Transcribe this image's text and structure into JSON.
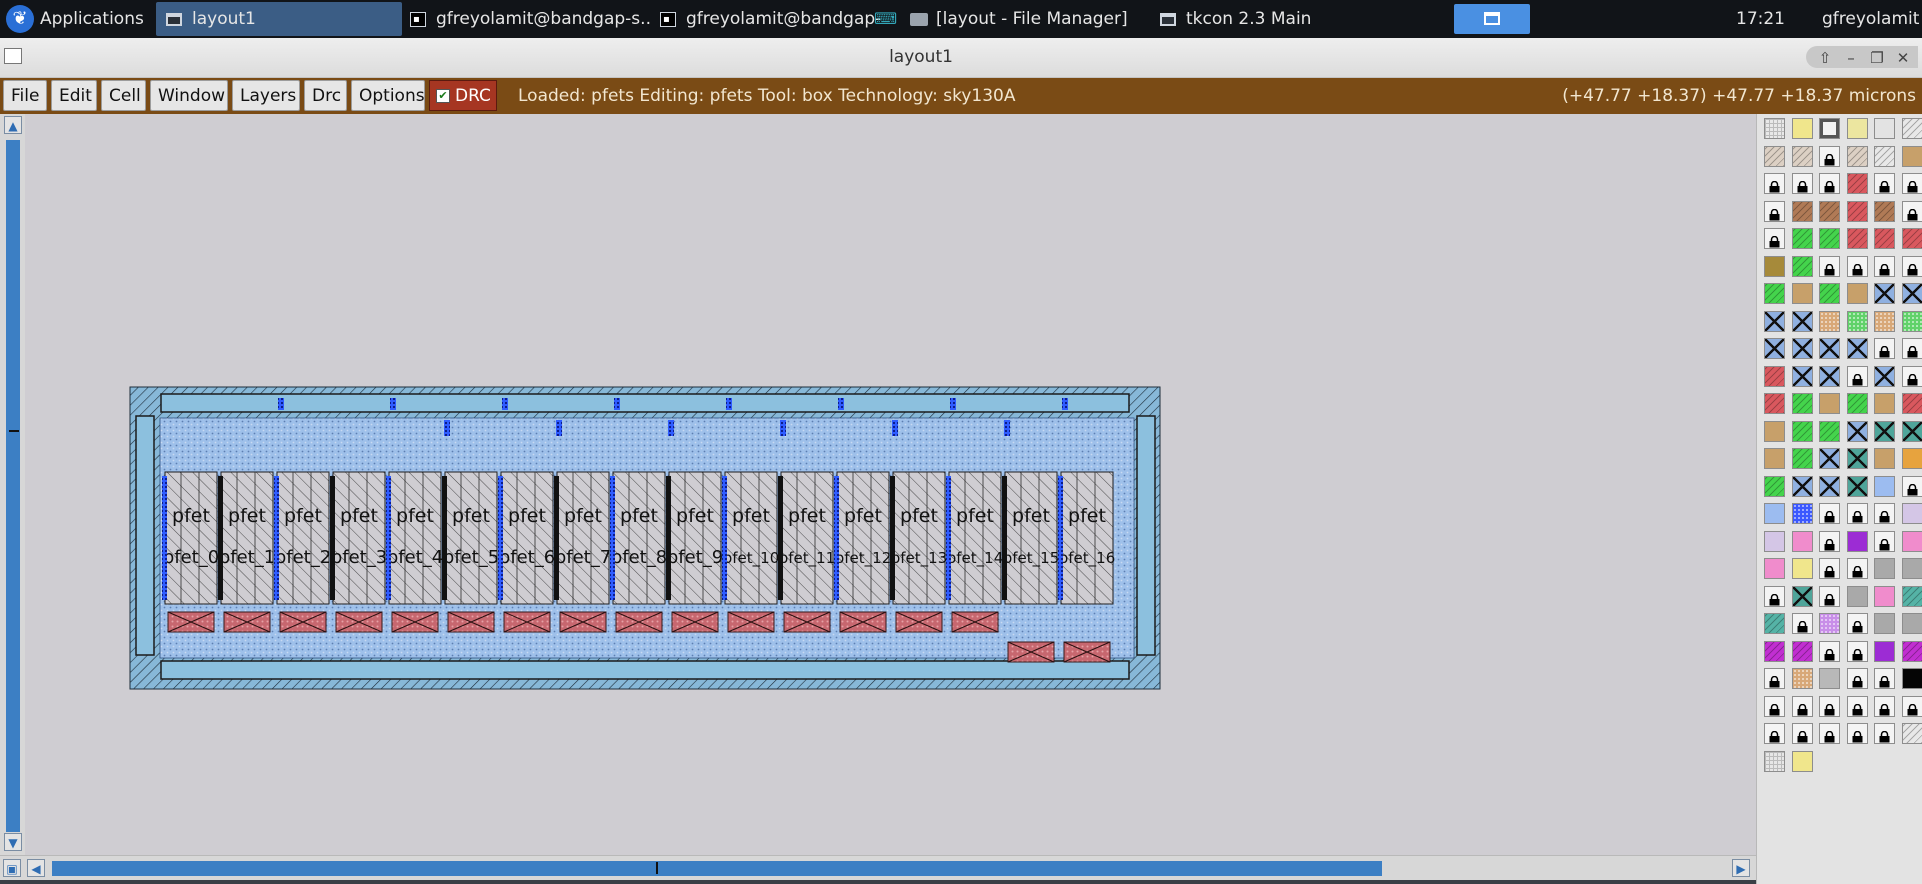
{
  "taskbar": {
    "applications_label": "Applications",
    "tasks": [
      {
        "label": "layout1",
        "active": true
      },
      {
        "label": "gfreyolamit@bandgap-s..."
      },
      {
        "label": "gfreyolamit@bandgap-"
      },
      {
        "label": "[layout - File Manager]"
      },
      {
        "label": "tkcon 2.3 Main"
      }
    ],
    "clock": "17:21",
    "user": "gfreyolamit"
  },
  "window": {
    "title": "layout1",
    "controls": [
      "up-arrow-icon",
      "minimize-icon",
      "maximize-icon",
      "close-icon"
    ]
  },
  "menu": {
    "items": [
      "File",
      "Edit",
      "Cell",
      "Window",
      "Layers",
      "Drc",
      "Options"
    ],
    "drc_label": "DRC",
    "drc_checked": true
  },
  "status": {
    "text": "Loaded: pfets Editing: pfets Tool: box  Technology: sky130A",
    "coords": "(+47.77 +18.37) +47.77 +18.37 microns"
  },
  "layout": {
    "cell_names": [
      "pfet",
      "pfet",
      "pfet",
      "pfet",
      "pfet",
      "pfet",
      "pfet",
      "pfet",
      "pfet",
      "pfet",
      "pfet",
      "pfet",
      "pfet",
      "pfet",
      "pfet",
      "pfet",
      "pfet"
    ],
    "instance_labels": [
      "pfet_0",
      "pfet_1",
      "pfet_2",
      "pfet_3",
      "pfet_4",
      "pfet_5",
      "pfet_6",
      "pfet_7",
      "pfet_8",
      "pfet_9",
      "pfet_10",
      "pfet_11",
      "pfet_12",
      "pfet_13",
      "pfet_14",
      "pfet_15",
      "pfet_16"
    ],
    "colors": {
      "canvas": "#cfcdd2",
      "diffusion": "#9cc3e0",
      "metal": "#8fb6e8",
      "contact": "#c56a73",
      "via": "#1b3fe0"
    }
  },
  "palette": {
    "rows": [
      [
        "grid",
        "yellow",
        "boxed",
        "pale-yellow",
        "blank",
        "hatch"
      ],
      [
        "beige-hatch",
        "beige-hatch",
        "lock",
        "beige-hatch",
        "hatch",
        "tan"
      ],
      [
        "lock",
        "lock",
        "lock",
        "red",
        "lock",
        "lock"
      ],
      [
        "lock",
        "brown",
        "brown",
        "red",
        "brown",
        "lock"
      ],
      [
        "lock",
        "green",
        "green",
        "red",
        "red",
        "red"
      ],
      [
        "olive",
        "green",
        "lock",
        "lock",
        "lock",
        "lock"
      ],
      [
        "green",
        "tan",
        "green",
        "tan",
        "blue-x",
        "blue-x"
      ],
      [
        "blue-x",
        "blue-x",
        "tan-dots",
        "green-dots",
        "tan-dots",
        "green-dots"
      ],
      [
        "blue-x",
        "blue-x",
        "blue-x",
        "blue-x",
        "lock",
        "lock"
      ],
      [
        "red",
        "blue-x",
        "blue-x",
        "lock",
        "blue-x",
        "lock"
      ],
      [
        "red",
        "green",
        "tan",
        "green",
        "tan",
        "red"
      ],
      [
        "tan",
        "green",
        "green",
        "blue-x",
        "teal-x",
        "teal-x"
      ],
      [
        "tan",
        "green",
        "blue-x",
        "teal-x",
        "tan",
        "orange"
      ],
      [
        "green",
        "blue-x",
        "blue-x",
        "teal-x",
        "light-blue",
        "lock"
      ],
      [
        "light-blue",
        "blue-dots",
        "lock",
        "lock",
        "lock",
        "lavender"
      ],
      [
        "lavender",
        "pink",
        "lock",
        "purple",
        "lock",
        "pink"
      ],
      [
        "pink",
        "yellow",
        "lock",
        "lock",
        "grey",
        "grey"
      ],
      [
        "lock",
        "teal-x",
        "lock",
        "grey",
        "pink",
        "teal"
      ],
      [
        "teal",
        "lock",
        "purple-dots",
        "lock",
        "grey",
        "grey"
      ],
      [
        "magenta",
        "magenta",
        "lock",
        "lock",
        "purple",
        "magenta"
      ],
      [
        "lock",
        "tan-dots",
        "grey-lines",
        "lock",
        "lock",
        "black"
      ],
      [
        "lock",
        "lock",
        "lock",
        "lock",
        "lock",
        "lock"
      ],
      [
        "lock",
        "lock",
        "lock",
        "lock",
        "lock",
        "hatch"
      ],
      [
        "light-grey",
        "yellow"
      ]
    ]
  }
}
